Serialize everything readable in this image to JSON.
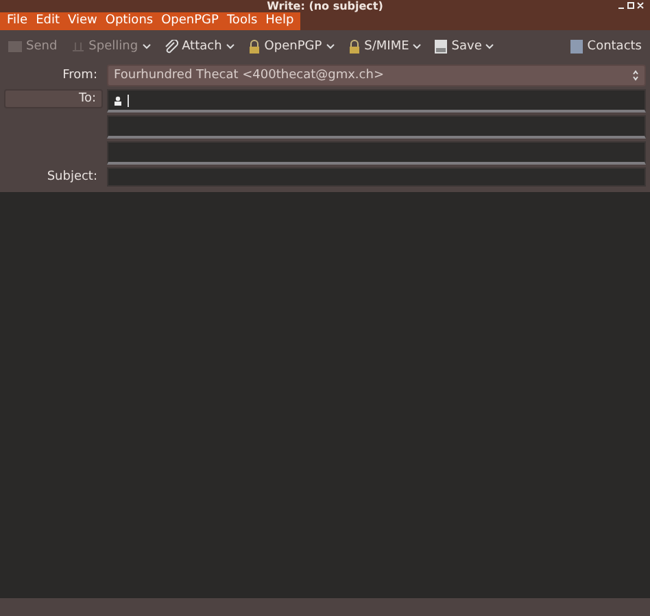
{
  "window": {
    "title": "Write: (no subject)"
  },
  "menu": [
    {
      "label": "File"
    },
    {
      "label": "Edit"
    },
    {
      "label": "View"
    },
    {
      "label": "Options"
    },
    {
      "label": "OpenPGP"
    },
    {
      "label": "Tools"
    },
    {
      "label": "Help"
    }
  ],
  "toolbar": [
    {
      "label": "Send",
      "kind": "send",
      "disabled": true,
      "dropdown": false
    },
    {
      "label": "Spelling",
      "kind": "spelling",
      "disabled": true,
      "dropdown": true
    },
    {
      "label": "Attach",
      "kind": "attach",
      "disabled": false,
      "dropdown": true
    },
    {
      "label": "OpenPGP",
      "kind": "lock",
      "disabled": false,
      "dropdown": true
    },
    {
      "label": "S/MIME",
      "kind": "lock",
      "disabled": false,
      "dropdown": true
    },
    {
      "label": "Save",
      "kind": "save",
      "disabled": false,
      "dropdown": true
    }
  ],
  "contacts": {
    "label": "Contacts"
  },
  "from": {
    "label": "From:",
    "value": "Fourhundred Thecat <400thecat@gmx.ch>"
  },
  "to": {
    "label": "To:"
  },
  "subject": {
    "label": "Subject:"
  }
}
